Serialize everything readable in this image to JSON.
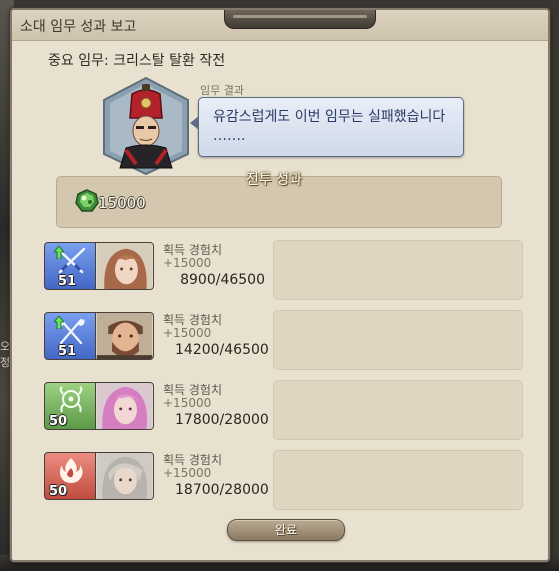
{
  "window": {
    "title": "소대 임무 성과 보고",
    "subtitle": "중요 임무: 크리스탈 탈환 작전"
  },
  "dialog": {
    "label": "임무 결과",
    "message": "유감스럽게도 이번 임무는 실패했습니다\n……."
  },
  "battle_results": {
    "title": "전투 성과",
    "reward_value": "15000",
    "reward_icon": "green-gem-icon"
  },
  "members": [
    {
      "level": "51",
      "level_up": true,
      "class_icon": "crossed-swords-icon",
      "class_color": "#4f78d8",
      "exp_label": "획득 경험치",
      "exp_gain": "+15000",
      "exp_progress": "8900/46500",
      "portrait": "portrait-female-brown-hair"
    },
    {
      "level": "51",
      "level_up": true,
      "class_icon": "crossed-axes-icon",
      "class_color": "#4f78d8",
      "exp_label": "획득 경험치",
      "exp_gain": "+15000",
      "exp_progress": "14200/46500",
      "portrait": "portrait-male-bearded"
    },
    {
      "level": "50",
      "level_up": false,
      "class_icon": "healer-wreath-icon",
      "class_color": "#6fae57",
      "exp_label": "획득 경험치",
      "exp_gain": "+15000",
      "exp_progress": "17800/28000",
      "portrait": "portrait-female-pink-hair"
    },
    {
      "level": "50",
      "level_up": false,
      "class_icon": "fire-mage-icon",
      "class_color": "#cf5a4d",
      "exp_label": "획득 경험치",
      "exp_gain": "+15000",
      "exp_progress": "18700/28000",
      "portrait": "portrait-female-silver-hair"
    }
  ],
  "footer": {
    "confirm_label": "완료"
  },
  "background": {
    "side_glyphs": [
      "오",
      "정"
    ]
  }
}
